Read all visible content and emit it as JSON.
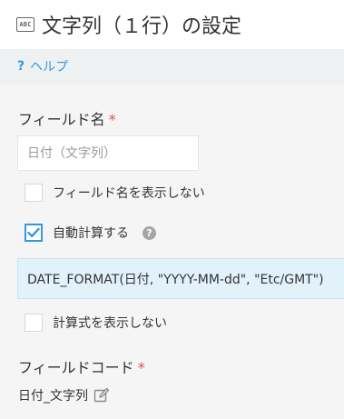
{
  "header": {
    "icon": "abc-text-icon",
    "icon_text": "ABC",
    "title": "文字列（１行）の設定"
  },
  "help": {
    "icon_text": "?",
    "label": "ヘルプ"
  },
  "field_name": {
    "label": "フィールド名",
    "required_mark": "*",
    "placeholder": "日付（文字列）"
  },
  "options": {
    "hide_field_name": {
      "label": "フィールド名を表示しない",
      "checked": false
    },
    "auto_calc": {
      "label": "自動計算する",
      "checked": true,
      "help_icon_text": "?"
    }
  },
  "formula": {
    "value": "DATE_FORMAT(日付, \"YYYY-MM-dd\", \"Etc/GMT\")"
  },
  "hide_formula": {
    "label": "計算式を表示しない",
    "checked": false
  },
  "field_code": {
    "label": "フィールドコード",
    "required_mark": "*",
    "value": "日付_文字列",
    "edit_icon": "pencil-edit-icon"
  },
  "colors": {
    "accent": "#3498db",
    "required": "#e74c3c",
    "formula_bg": "#e2f2fb",
    "panel_bg": "#f5f5f5"
  }
}
